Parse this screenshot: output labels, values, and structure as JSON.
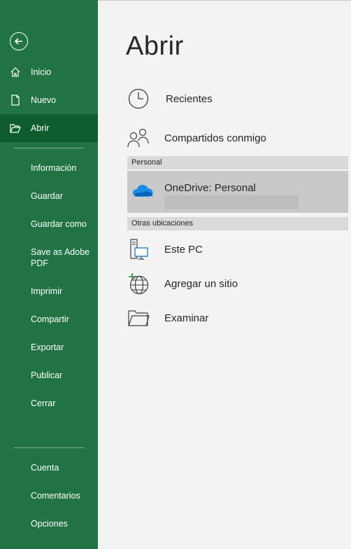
{
  "sidebar": {
    "primary": [
      {
        "label": "Inicio",
        "icon": "home-icon"
      },
      {
        "label": "Nuevo",
        "icon": "new-file-icon"
      },
      {
        "label": "Abrir",
        "icon": "open-folder-icon",
        "active": true
      }
    ],
    "secondary": [
      "Información",
      "Guardar",
      "Guardar como",
      "Save as Adobe PDF",
      "Imprimir",
      "Compartir",
      "Exportar",
      "Publicar",
      "Cerrar"
    ],
    "footer": [
      "Cuenta",
      "Comentarios",
      "Opciones"
    ]
  },
  "main": {
    "title": "Abrir",
    "recent": "Recientes",
    "shared": "Compartidos conmigo",
    "personal_header": "Personal",
    "onedrive": "OneDrive: Personal",
    "other_header": "Otras ubicaciones",
    "this_pc": "Este PC",
    "add_site": "Agregar un sitio",
    "browse": "Examinar"
  },
  "colors": {
    "sidebar": "#217346",
    "active": "#0e5c2f",
    "onedrive": "#0364b8"
  }
}
